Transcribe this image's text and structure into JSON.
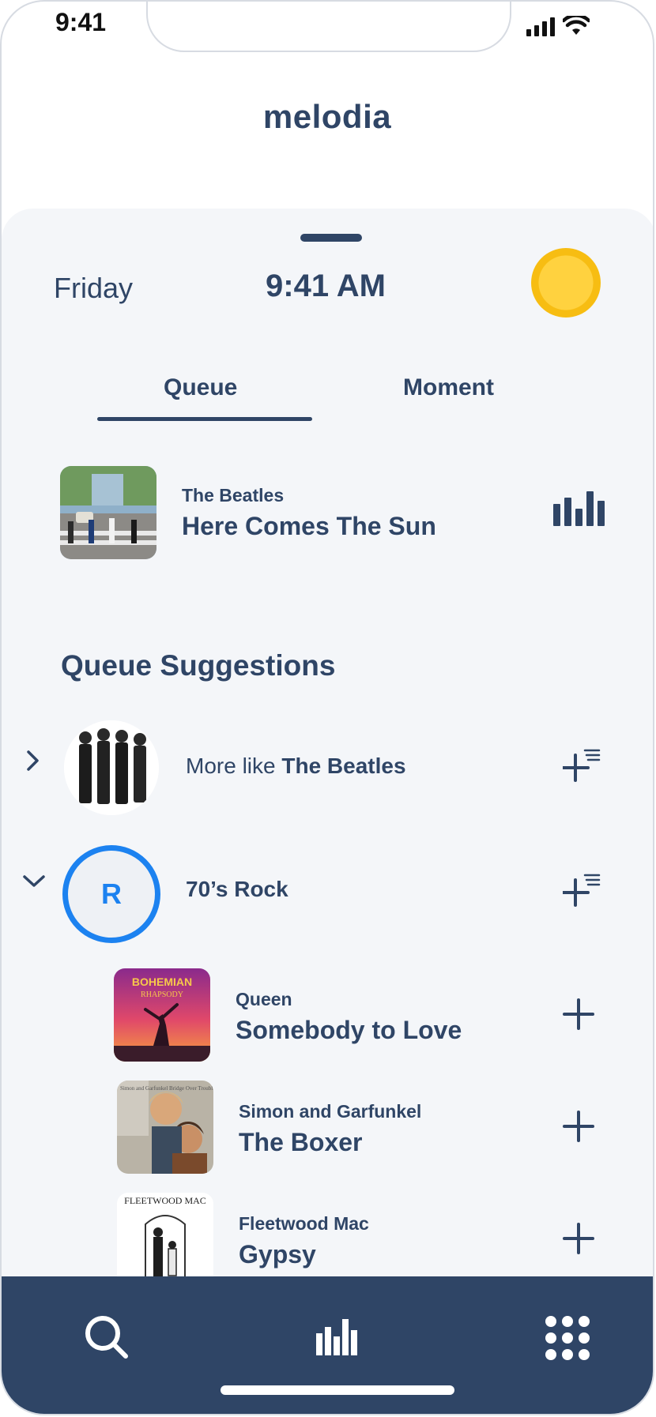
{
  "status_bar": {
    "time": "9:41"
  },
  "app": {
    "title": "melodia"
  },
  "header": {
    "day": "Friday",
    "time": "9:41 AM"
  },
  "tabs": [
    {
      "label": "Queue",
      "active": true
    },
    {
      "label": "Moment",
      "active": false
    }
  ],
  "now_playing": {
    "artist": "The Beatles",
    "title": "Here Comes The Sun",
    "icon": "equalizer-icon"
  },
  "suggestions": {
    "title": "Queue Suggestions",
    "items": [
      {
        "prefix": "More like ",
        "name": "The Beatles",
        "expanded": false
      },
      {
        "avatar_letter": "R",
        "name": "70’s Rock",
        "expanded": true
      }
    ]
  },
  "tracks": [
    {
      "artist": "Queen",
      "title": "Somebody to Love",
      "art_text": "BOHEMIAN",
      "art_subtext": "RHAPSODY"
    },
    {
      "artist": "Simon and Garfunkel",
      "title": "The Boxer",
      "art_text": "Simon and Garfunkel Bridge Over Troubled Water"
    },
    {
      "artist": "Fleetwood Mac",
      "title": "Gypsy",
      "art_text": "FLEETWOOD MAC"
    }
  ],
  "nav": {
    "items": [
      "search-icon",
      "equalizer-icon",
      "apps-grid-icon"
    ]
  },
  "colors": {
    "primary": "#2f4566",
    "accent": "#1c82f0",
    "sun": "#f7bd12",
    "background": "#f4f6f9"
  }
}
